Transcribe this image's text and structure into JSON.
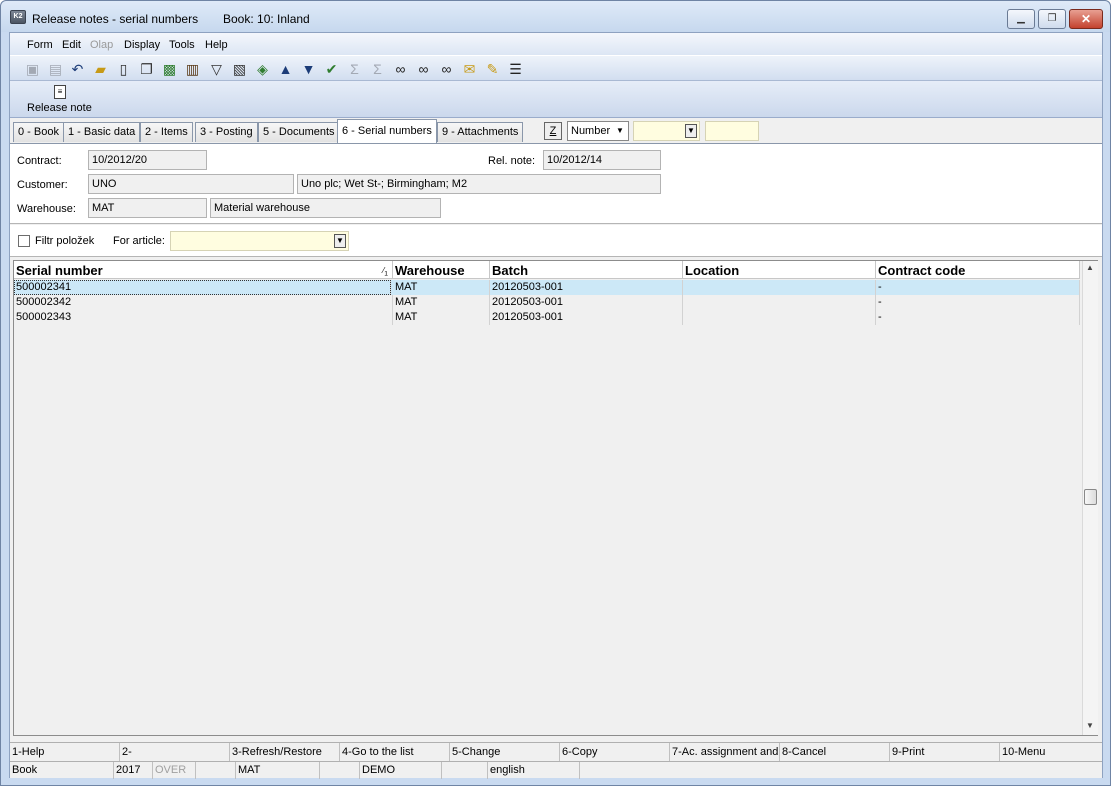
{
  "window": {
    "title": "Release notes - serial numbers",
    "book": "Book: 10: Inland",
    "app_icon_text": "K2"
  },
  "menu": {
    "items": [
      "Form",
      "Edit",
      "Olap",
      "Display",
      "Tools",
      "Help"
    ]
  },
  "toolbar": {
    "icons": [
      "save-icon",
      "save-as-icon",
      "undo-icon",
      "open-folder-icon",
      "new-document-icon",
      "copy-icon",
      "lock-icon",
      "book-icon",
      "filter-icon",
      "clipboard-filter-icon",
      "stack-icon",
      "arrow-up-icon",
      "arrow-down-icon",
      "check-arrow-icon",
      "sum-icon",
      "sum-gray-icon",
      "binoculars-icon",
      "binoculars-next-icon",
      "binoculars-filter-icon",
      "envelope-icon",
      "notes-icon",
      "menu-lines-icon"
    ]
  },
  "action": {
    "release_note_label": "Release note"
  },
  "tabs": [
    "0 - Book",
    "1 - Basic data",
    "2 - Items",
    "3 - Posting",
    "5 - Documents",
    "6 - Serial numbers",
    "9 - Attachments"
  ],
  "tab_controls": {
    "z_label": "Z",
    "sort_value": "Number"
  },
  "form": {
    "contract_label": "Contract:",
    "contract_value": "10/2012/20",
    "rel_note_label": "Rel. note:",
    "rel_note_value": "10/2012/14",
    "customer_label": "Customer:",
    "customer_code": "UNO",
    "customer_address": "Uno plc; Wet St-; Birmingham; M2",
    "warehouse_label": "Warehouse:",
    "warehouse_code": "MAT",
    "warehouse_name": "Material warehouse"
  },
  "filter": {
    "checkbox_label": "Filtr položek",
    "article_label": "For article:",
    "article_value": ""
  },
  "grid": {
    "columns": [
      "Serial number",
      "Warehouse",
      "Batch",
      "Location",
      "Contract code"
    ],
    "sort_indicator": "1",
    "rows": [
      {
        "serial": "500002341",
        "warehouse": "MAT",
        "batch": "20120503-001",
        "location": "",
        "contract": "-"
      },
      {
        "serial": "500002342",
        "warehouse": "MAT",
        "batch": "20120503-001",
        "location": "",
        "contract": "-"
      },
      {
        "serial": "500002343",
        "warehouse": "MAT",
        "batch": "20120503-001",
        "location": "",
        "contract": "-"
      }
    ]
  },
  "fkeys": [
    "1-Help",
    "2-",
    "3-Refresh/Restore",
    "4-Go to the list",
    "5-Change",
    "6-Copy",
    "7-Ac. assignment and",
    "8-Cancel",
    "9-Print",
    "10-Menu"
  ],
  "status": [
    "Book",
    "2017",
    "OVER",
    "",
    "MAT",
    "",
    "DEMO",
    "",
    "english"
  ]
}
